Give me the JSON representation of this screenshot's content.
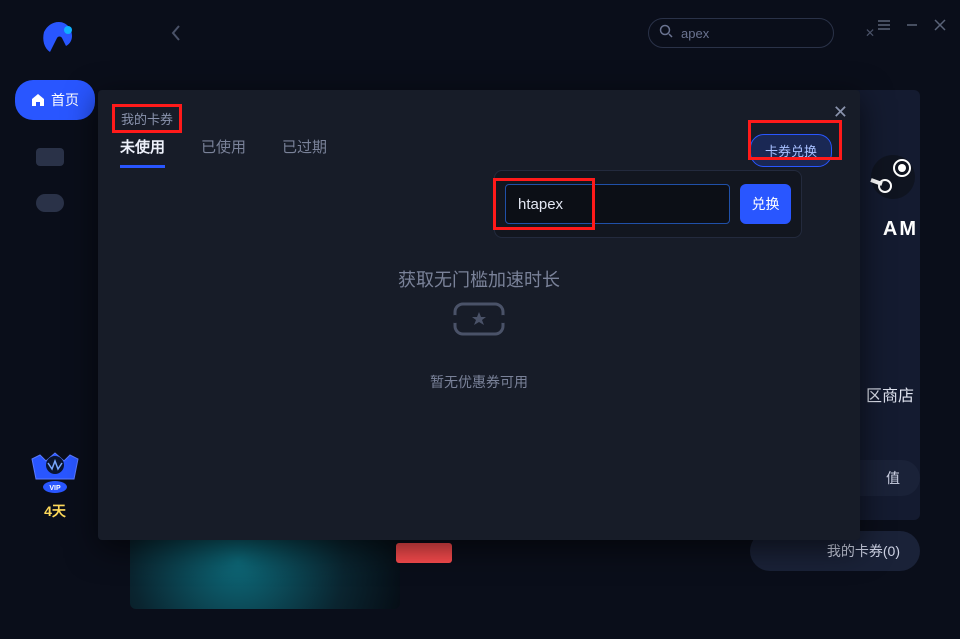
{
  "colors": {
    "accent": "#2956ff",
    "highlight": "#ff1a1a",
    "text_muted": "#7a8299"
  },
  "search": {
    "value": "apex",
    "placeholder": ""
  },
  "sidebar": {
    "home_label": "首页"
  },
  "vip": {
    "days": "4天",
    "badge_label": "VIP"
  },
  "right": {
    "brand": "AM",
    "store_label": "区商店",
    "chip1": "值",
    "coupon_label": "我的卡券(0)"
  },
  "modal": {
    "title": "我的卡券",
    "tabs": {
      "unused": "未使用",
      "used": "已使用",
      "expired": "已过期"
    },
    "redeem_label": "卡券兑换",
    "code_value": "htapex",
    "code_btn": "兑换",
    "banner": "获取无门槛加速时长",
    "empty": "暂无优惠券可用"
  }
}
